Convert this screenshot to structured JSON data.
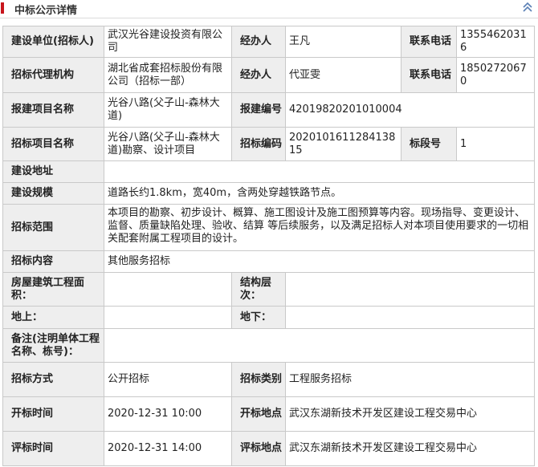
{
  "header": {
    "title": "中标公示详情",
    "collapse_icon": "chevron-up-double-icon",
    "accent_color": "#c8161d"
  },
  "rows": {
    "r1": {
      "l1": "建设单位(招标人)",
      "v1": "武汉光谷建设投资有限公司",
      "l2": "经办人",
      "v2": "王凡",
      "l3": "联系电话",
      "v3": "13554620316"
    },
    "r2": {
      "l1": "招标代理机构",
      "v1": "湖北省成套招标股份有限公司（招标一部）",
      "l2": "经办人",
      "v2": "代亚雯",
      "l3": "联系电话",
      "v3": "18502720670"
    },
    "r3": {
      "l1": "报建项目名称",
      "v1": "光谷八路(父子山-森林大道)",
      "l2": "报建编号",
      "v2": "42019820201010004"
    },
    "r4": {
      "l1": "招标项目名称",
      "v1": "光谷八路(父子山-森林大道)勘察、设计项目",
      "l2": "招标编码",
      "v2": "202010161128413815",
      "l3": "标段号",
      "v3": "1"
    },
    "r5": {
      "l1": "建设地址",
      "v1": ""
    },
    "r6": {
      "l1": "建设规模",
      "v1": "道路长约1.8km，宽40m，含两处穿越铁路节点。"
    },
    "r7": {
      "l1": "招标范围",
      "v1": "本项目的勘察、初步设计、概算、施工图设计及施工图预算等内容。现场指导、变更设计、监督、质量缺陷处理、验收、结算 等后续服务，以及满足招标人对本项目使用要求的一切相关配套附属工程项目的设计。"
    },
    "r8": {
      "l1": "招标内容",
      "v1": "其他服务招标"
    },
    "r9": {
      "l1": "房屋建筑工程面积：",
      "v1": "",
      "l2": "结构层次：",
      "v2": ""
    },
    "r10": {
      "l1": "地上：",
      "v1": "",
      "l2": "地下：",
      "v2": ""
    },
    "r11": {
      "l1": "备注(注明单体工程名称、栋号)：",
      "v1": ""
    },
    "r12": {
      "l1": "招标方式",
      "v1": "公开招标",
      "l2": "招标类别",
      "v2": "工程服务招标"
    },
    "r13": {
      "l1": "开标时间",
      "v1": "2020-12-31 10:00",
      "l2": "开标地点",
      "v2": "武汉东湖新技术开发区建设工程交易中心"
    },
    "r14": {
      "l1": "评标时间",
      "v1": "2020-12-31 14:00",
      "l2": "评标地点",
      "v2": "武汉东湖新技术开发区建设工程交易中心"
    }
  }
}
